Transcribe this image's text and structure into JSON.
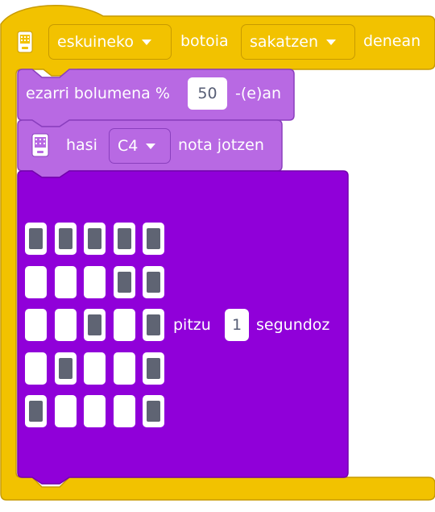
{
  "hat": {
    "button_dropdown": "eskuineko",
    "label_button": "botoia",
    "action_dropdown": "sakatzen",
    "label_when": "denean"
  },
  "volume_block": {
    "label_prefix": "ezarri bolumena %",
    "value": "50",
    "label_suffix": "-(e)an"
  },
  "note_block": {
    "label_start": "hasi",
    "note_dropdown": "C4",
    "label_end": "nota jotzen"
  },
  "led_block": {
    "label_light": "pitzu",
    "seconds_value": "1",
    "label_seconds": "segundoz",
    "matrix": [
      [
        1,
        1,
        1,
        1,
        1
      ],
      [
        0,
        0,
        0,
        1,
        1
      ],
      [
        0,
        0,
        1,
        0,
        1
      ],
      [
        0,
        1,
        0,
        0,
        1
      ],
      [
        1,
        0,
        0,
        0,
        1
      ]
    ]
  },
  "colors": {
    "hat_block": "#f2c200",
    "sound_block": "#b869e3",
    "display_block": "#9000d9",
    "led_on": "#5f6473"
  },
  "icons": {
    "device": "microbit-device-icon"
  }
}
